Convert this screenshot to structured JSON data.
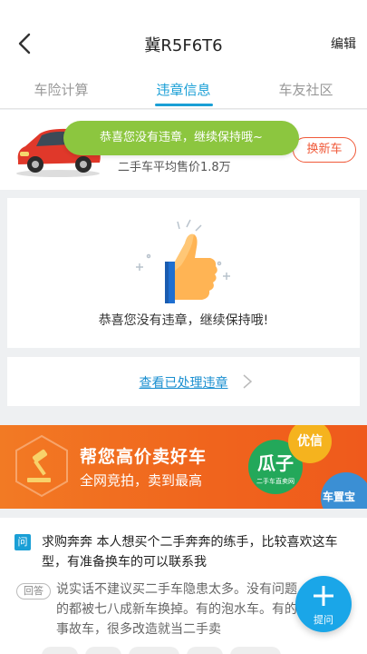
{
  "header": {
    "title": "冀R5F6T6",
    "edit_label": "编辑",
    "back_icon": "back-arrow-icon"
  },
  "tabs": [
    {
      "label": "车险计算",
      "active": false
    },
    {
      "label": "违章信息",
      "active": true
    },
    {
      "label": "车友社区",
      "active": false
    }
  ],
  "car": {
    "price_text": "二手车平均售价1.8万",
    "change_label": "换新车",
    "accent": "#f05a3a"
  },
  "toast": {
    "text": "恭喜您没有违章，继续保持哦~",
    "color": "#8cc63f"
  },
  "congrats": {
    "text": "恭喜您没有违章，继续保持哦!",
    "icon": "thumbs-up-icon"
  },
  "history": {
    "link_text": "查看已处理违章"
  },
  "banner": {
    "title": "帮您高价卖好车",
    "subtitle": "全网竞拍，卖到最高",
    "guazi_main": "瓜子",
    "guazi_small": "二手车直卖网",
    "youxin": "优信",
    "chezhibao": "车置宝"
  },
  "qa": {
    "q_badge": "问",
    "question": "求购奔奔 本人想买个二手奔奔的练手，比较喜欢这车型，有准备换车的可以联系我",
    "a_badge": "回答",
    "answer": "说实话不建议买二手车隐患太多。没有问题的都被七八成新车换掉。有的泡水车。有的事故车，很多改造就当二手卖"
  },
  "fab": {
    "label": "提问",
    "color": "#1aa6e8"
  }
}
